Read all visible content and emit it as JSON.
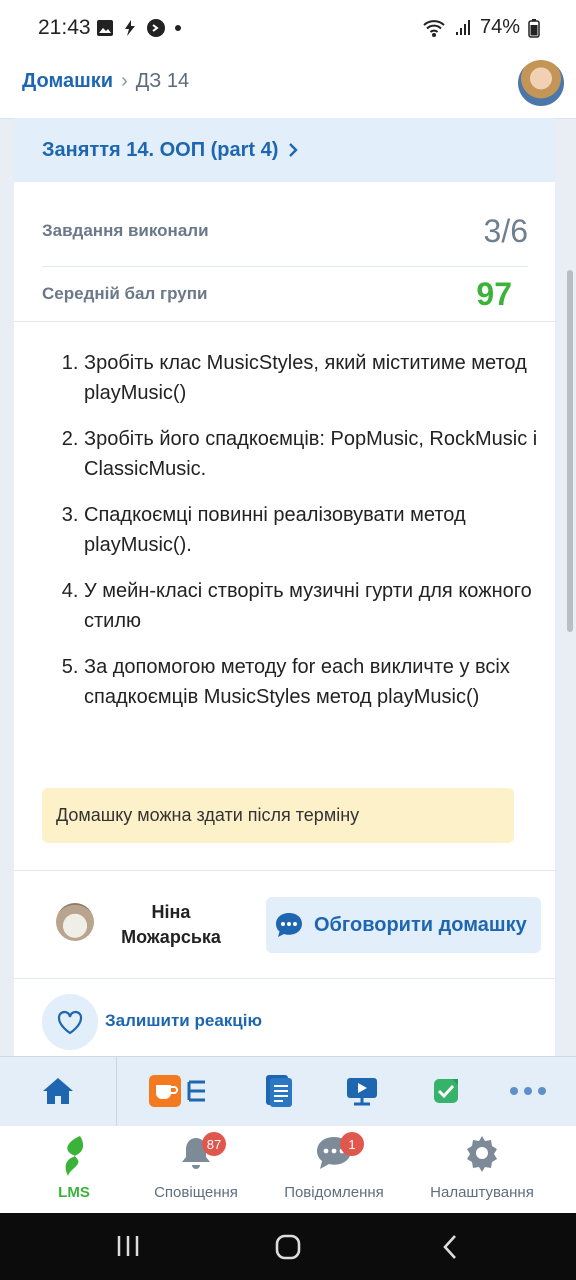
{
  "status_bar": {
    "time": "21:43",
    "battery": "74%",
    "icons": [
      "gallery-icon",
      "bolt-icon",
      "shazam-icon",
      "dot-icon",
      "wifi-icon",
      "signal-icon",
      "battery-icon"
    ]
  },
  "breadcrumb": {
    "home": "Домашки",
    "current": "ДЗ 14"
  },
  "lesson": {
    "title": "Заняття 14. ООП (part 4)"
  },
  "stats": [
    {
      "label": "Завдання виконали",
      "value": "3/6"
    },
    {
      "label": "Середній бал групи",
      "value": "97"
    }
  ],
  "tasks": [
    "Зробіть клас MusicStyles, який міститиме метод playMusic()",
    "Зробіть його спадкоємців: PopMusic, RockMusic і ClassicMusic.",
    "Спадкоємці повинні реалізовувати метод playMusic().",
    "У мейн-класі створіть музичні гурти для кожного стилю",
    "За допомогою методу for each викличте у всіх спадкоємців MusicStyles метод playMusic()"
  ],
  "notice": "Домашку можна здати після терміну",
  "author": {
    "name": "Ніна Можарська"
  },
  "discuss_button": "Обговорити домашку",
  "reaction_label": "Залишити реакцію",
  "toolbar": [
    "home-icon",
    "coffee-list-icon",
    "document-icon",
    "video-icon",
    "check-icon",
    "more-icon"
  ],
  "bottom_nav": [
    {
      "label": "LMS",
      "icon": "lms-leaf-icon"
    },
    {
      "label": "Сповіщення",
      "icon": "bell-icon",
      "badge": "87"
    },
    {
      "label": "Повідомлення",
      "icon": "chat-icon",
      "badge": "1"
    },
    {
      "label": "Налаштування",
      "icon": "gear-icon"
    }
  ],
  "colors": {
    "accent": "#1e67b0",
    "success": "#3bb33b",
    "notice_bg": "#fcf1c8",
    "badge": "#e0584d"
  }
}
